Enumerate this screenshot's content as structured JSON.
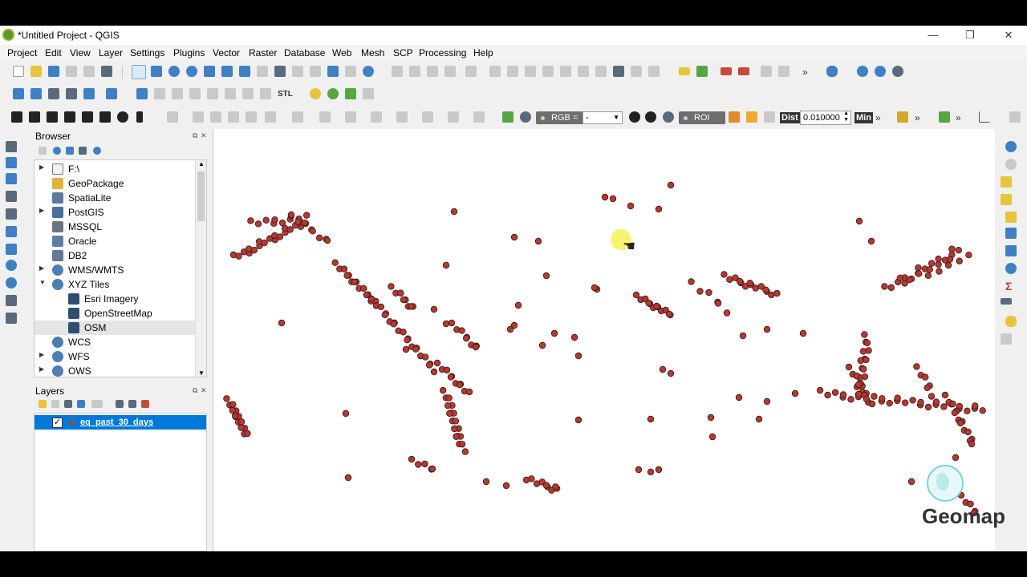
{
  "window": {
    "title": "*Untitled Project - QGIS",
    "controls": {
      "minimize": "—",
      "maximize": "❐",
      "close": "✕"
    }
  },
  "menu": [
    "Project",
    "Edit",
    "View",
    "Layer",
    "Settings",
    "Plugins",
    "Vector",
    "Raster",
    "Database",
    "Web",
    "Mesh",
    "SCP",
    "Processing",
    "Help"
  ],
  "toolbars": {
    "more": "»",
    "stl_label": "STL",
    "scp": {
      "rgb_label": "RGB =",
      "rgb_value": "-",
      "roi_label": "ROI",
      "dist_label": "Dist",
      "dist_value": "0.010000",
      "min_label": "Min"
    }
  },
  "browser": {
    "title": "Browser",
    "items": [
      {
        "label": "F:\\",
        "icon": "folder-icon",
        "expandable": true,
        "indent": 0
      },
      {
        "label": "GeoPackage",
        "icon": "geopackage-icon",
        "expandable": false,
        "indent": 0
      },
      {
        "label": "SpatiaLite",
        "icon": "spatialite-icon",
        "expandable": false,
        "indent": 0
      },
      {
        "label": "PostGIS",
        "icon": "postgis-icon",
        "expandable": true,
        "indent": 0
      },
      {
        "label": "MSSQL",
        "icon": "mssql-icon",
        "expandable": false,
        "indent": 0
      },
      {
        "label": "Oracle",
        "icon": "oracle-icon",
        "expandable": false,
        "indent": 0
      },
      {
        "label": "DB2",
        "icon": "db2-icon",
        "expandable": false,
        "indent": 0
      },
      {
        "label": "WMS/WMTS",
        "icon": "globe-icon",
        "expandable": true,
        "indent": 0
      },
      {
        "label": "XYZ Tiles",
        "icon": "globe-icon",
        "expandable": true,
        "expanded": true,
        "indent": 0
      },
      {
        "label": "Esri Imagery",
        "icon": "xyz-tile-icon",
        "expandable": false,
        "indent": 1
      },
      {
        "label": "OpenStreetMap",
        "icon": "xyz-tile-icon",
        "expandable": false,
        "indent": 1
      },
      {
        "label": "OSM",
        "icon": "xyz-tile-icon",
        "expandable": false,
        "indent": 1,
        "hover": true
      },
      {
        "label": "WCS",
        "icon": "globe-icon",
        "expandable": false,
        "indent": 0
      },
      {
        "label": "WFS",
        "icon": "globe-icon",
        "expandable": true,
        "indent": 0
      },
      {
        "label": "OWS",
        "icon": "globe-icon",
        "expandable": true,
        "indent": 0
      }
    ]
  },
  "layers": {
    "title": "Layers",
    "items": [
      {
        "name": "eq_past_30_days",
        "visible": true,
        "selected": true,
        "symbol_color": "#c0392b"
      }
    ]
  },
  "map": {
    "point_color": "#b23a33",
    "point_stroke": "#3a1412",
    "cursor": "hand-pointer-icon",
    "highlight_color": "#f5ef3c"
  },
  "watermark": {
    "text": "Geomap",
    "icon": "globe-icon"
  },
  "colors": {
    "selection": "#0078d7",
    "chrome": "#f0f0f0"
  }
}
